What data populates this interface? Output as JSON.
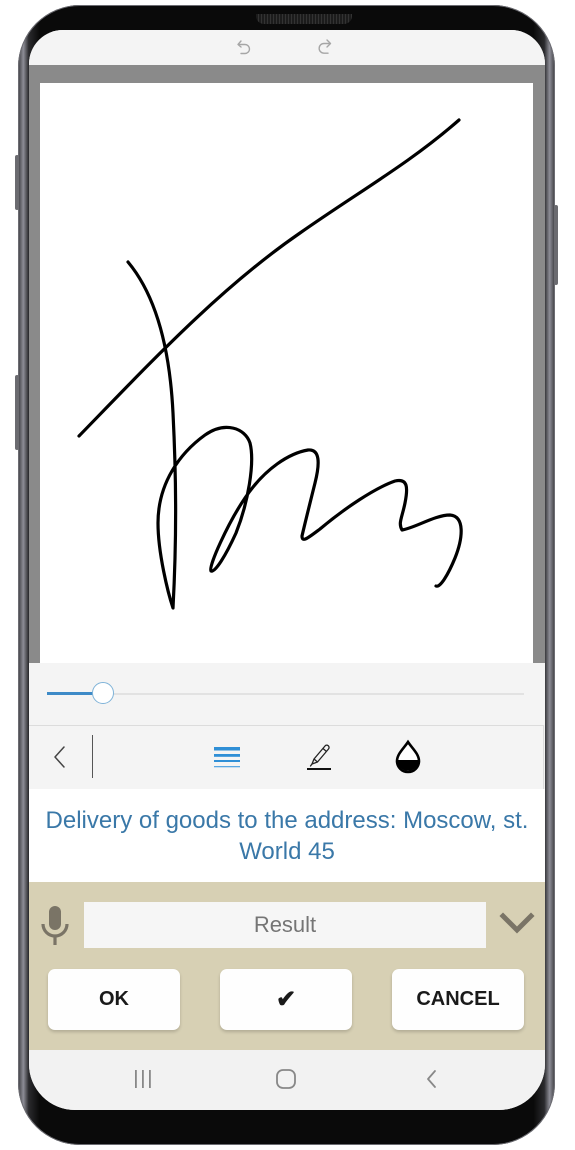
{
  "topbar": {
    "undo_icon": "undo-icon",
    "redo_icon": "redo-icon"
  },
  "canvas": {
    "background": "#ffffff",
    "frame_color": "#8a8a8a",
    "stroke_color": "#000000",
    "content": "handwritten signature"
  },
  "slider": {
    "value_fraction": 0.11,
    "fill_color": "#3d8ac7"
  },
  "toolbar": {
    "items": [
      {
        "name": "back",
        "icon": "chevron-left-icon"
      },
      {
        "name": "line-thickness",
        "icon": "line-weight-icon",
        "active": true,
        "color": "#2f8fd6"
      },
      {
        "name": "pen",
        "icon": "pen-icon"
      },
      {
        "name": "ink-color",
        "icon": "drop-icon"
      }
    ]
  },
  "description": {
    "text": "Delivery of goods to the address: Moscow, st. World 45",
    "color": "#3a78a8"
  },
  "panel": {
    "background": "#d7d0b4",
    "mic_icon": "microphone-icon",
    "result_placeholder": "Result",
    "result_value": "",
    "dropdown_icon": "chevron-down-icon",
    "buttons": {
      "ok": "OK",
      "check": "✔",
      "cancel": "CANCEL"
    }
  },
  "navbar": {
    "recents_icon": "recents-icon",
    "home_icon": "home-icon",
    "back_icon": "back-icon"
  }
}
